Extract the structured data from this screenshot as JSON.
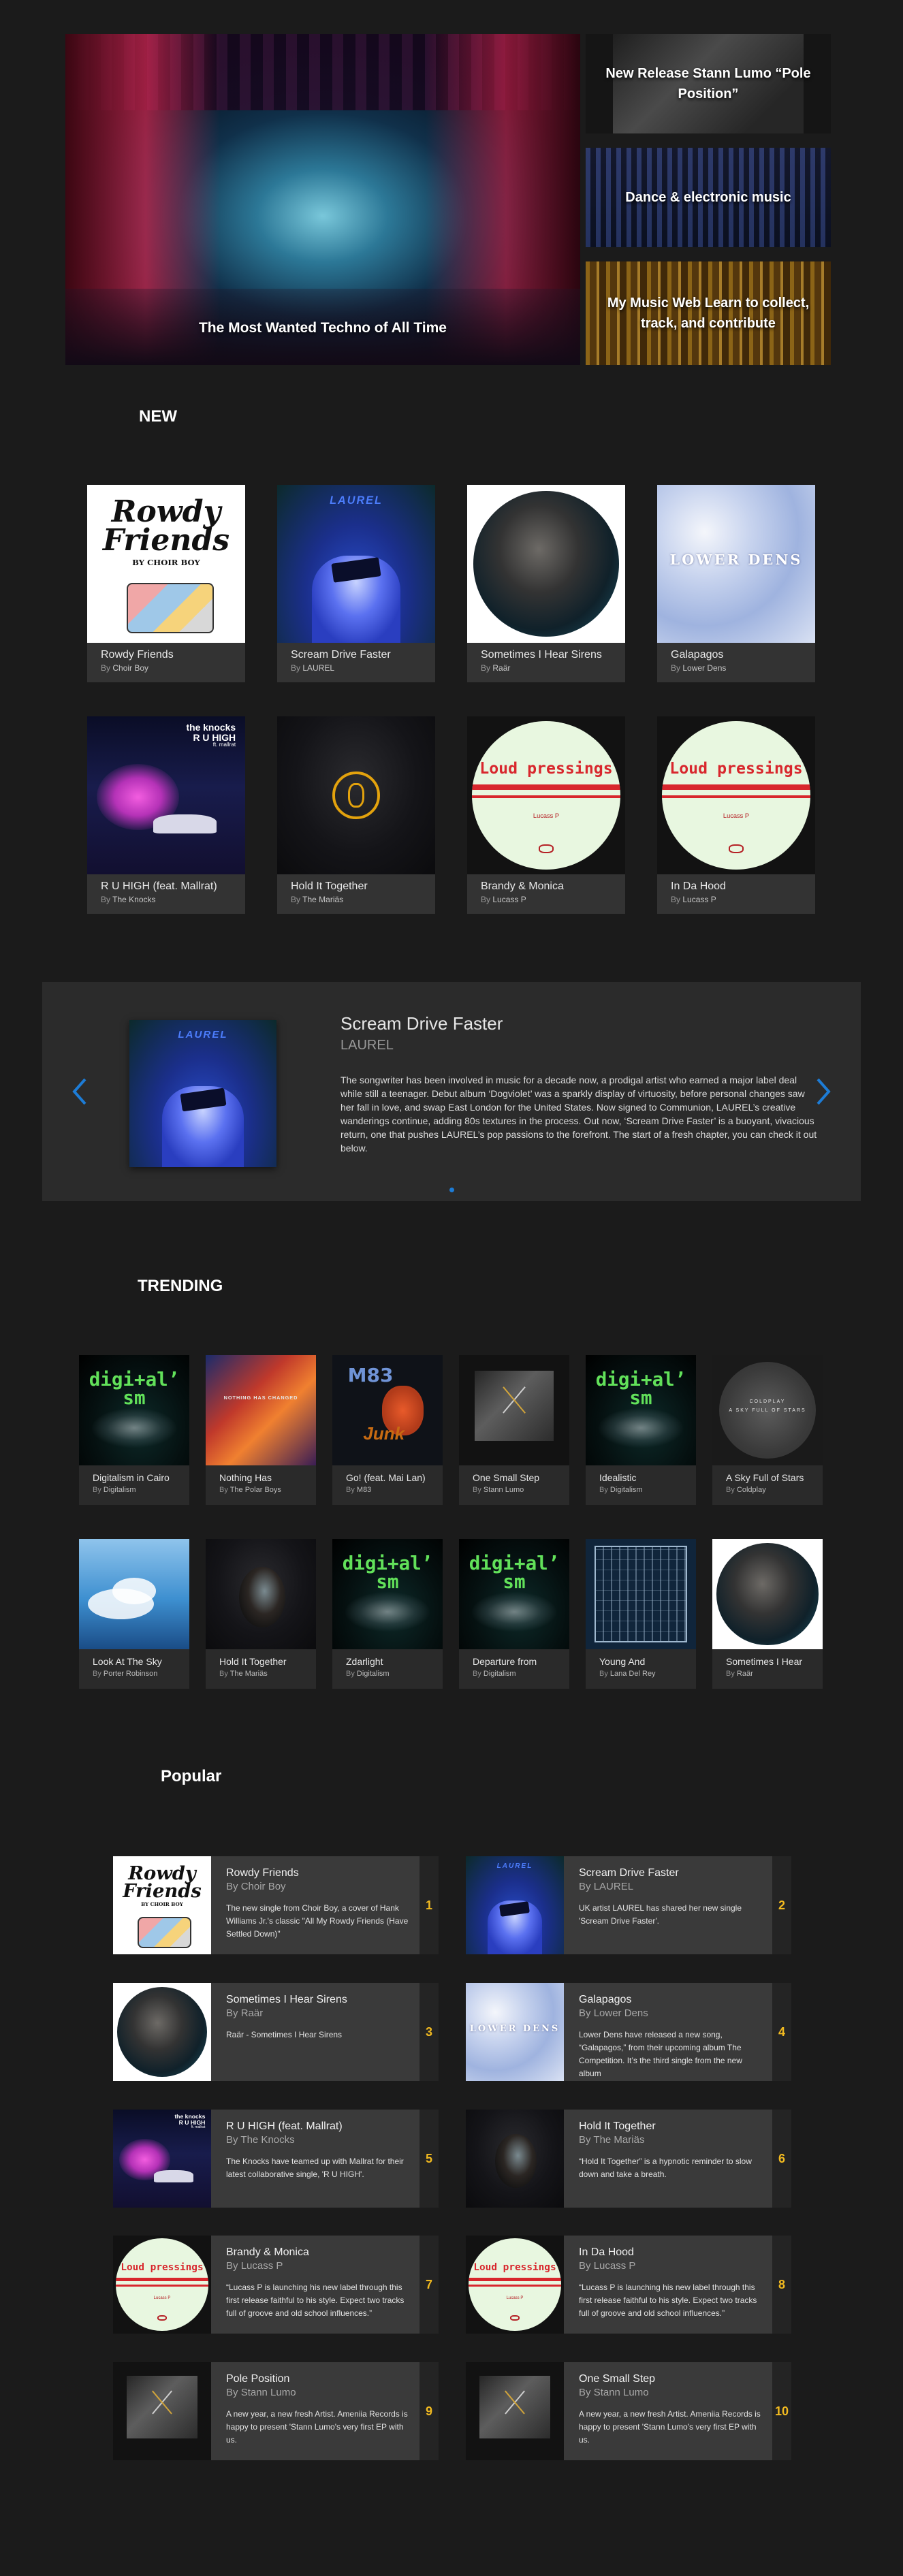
{
  "hero": {
    "main_caption": "The Most Wanted Techno of All Time",
    "side_items": [
      {
        "caption": "New Release Stann Lumo “Pole Position”"
      },
      {
        "caption": "Dance & electronic music"
      },
      {
        "caption": "My Music Web Learn to collect, track, and contribute"
      }
    ]
  },
  "new_section": {
    "title": "NEW",
    "by_prefix": "By",
    "items": [
      {
        "title": "Rowdy Friends",
        "artist": "Choir Boy",
        "art": "rowdy"
      },
      {
        "title": "Scream Drive Faster",
        "artist": "LAUREL",
        "art": "laurel"
      },
      {
        "title": "Sometimes I Hear Sirens",
        "artist": "Raär",
        "art": "sirens"
      },
      {
        "title": "Galapagos",
        "artist": "Lower Dens",
        "art": "galapagos"
      },
      {
        "title": "R U HIGH (feat. Mallrat)",
        "artist": "The Knocks",
        "art": "knocks"
      },
      {
        "title": "Hold It Together",
        "artist": "The Mariäs",
        "art": "marias"
      },
      {
        "title": "Brandy & Monica",
        "artist": "Lucass P",
        "art": "loud"
      },
      {
        "title": "In Da Hood",
        "artist": "Lucass P",
        "art": "loud"
      }
    ],
    "art_text": {
      "rowdy_line1": "Rowdy",
      "rowdy_line2": "Friends",
      "rowdy_small": "BY CHOIR BOY",
      "laurel": "LAUREL",
      "kowik": "LOWER DENS",
      "knocks_line1": "the knocks",
      "knocks_line2": "R U HIGH",
      "knocks_line3": "ft. mallrat",
      "loud": "Loud pressings",
      "loud_small": "Lucass P"
    }
  },
  "feature": {
    "title": "Scream Drive Faster",
    "artist": "LAUREL",
    "description": "The songwriter has been involved in music for a decade now, a prodigal artist who earned a major label deal while still a teenager. Debut album ‘Dogviolet’ was a sparkly display of virtuosity, before personal changes saw her fall in love, and swap East London for the United States. Now signed to Communion, LAUREL’s creative wanderings continue, adding 80s textures in the process. Out now, ‘Scream Drive Faster’ is a buoyant, vivacious return, one that pushes LAUREL’s pop passions to the forefront. The start of a fresh chapter, you can check it out below.",
    "prev_icon": "chevron-left-icon",
    "next_icon": "chevron-right-icon",
    "accent": "#1d7cd6",
    "dots_count": 1
  },
  "trending_section": {
    "title": "TRENDING",
    "by_prefix": "By",
    "items": [
      {
        "title": "Digitalism in Cairo",
        "artist": "Digitalism",
        "art": "digi"
      },
      {
        "title": "Nothing Has",
        "artist": "The Polar Boys",
        "art": "orange"
      },
      {
        "title": "Go! (feat. Mai Lan)",
        "artist": "M83",
        "art": "m83"
      },
      {
        "title": "One Small Step",
        "artist": "Stann Lumo",
        "art": "stann"
      },
      {
        "title": "Idealistic",
        "artist": "Digitalism",
        "art": "digi"
      },
      {
        "title": "A Sky Full of Stars",
        "artist": "Coldplay",
        "art": "coldplay"
      },
      {
        "title": "Look At The Sky",
        "artist": "Porter Robinson",
        "art": "sky"
      },
      {
        "title": "Hold It Together",
        "artist": "The Mariäs",
        "art": "marias"
      },
      {
        "title": "Zdarlight",
        "artist": "Digitalism",
        "art": "digi"
      },
      {
        "title": "Departure from",
        "artist": "Digitalism",
        "art": "digi"
      },
      {
        "title": "Young And",
        "artist": "Lana Del Rey",
        "art": "gatsby"
      },
      {
        "title": "Sometimes I Hear",
        "artist": "Raär",
        "art": "sirens"
      }
    ],
    "art_text": {
      "digi": "digi+al’ sm",
      "orange": "NOTHING HAS CHANGED",
      "m83": "M83",
      "junk": "Junk",
      "coldplay": "A SKY FULL OF STARS",
      "coldplay_top": "COLDPLAY"
    }
  },
  "popular_section": {
    "title": "Popular",
    "by_prefix": "By",
    "items": [
      {
        "rank": "1",
        "title": "Rowdy Friends",
        "artist": "Choir Boy",
        "desc": "The new single from Choir Boy, a cover of Hank Williams Jr.'s classic \"All My Rowdy Friends (Have Settled Down)\"",
        "art": "rowdy"
      },
      {
        "rank": "2",
        "title": "Scream Drive Faster",
        "artist": "LAUREL",
        "desc": "UK artist LAUREL has shared her new single 'Scream Drive Faster'.",
        "art": "laurel"
      },
      {
        "rank": "3",
        "title": "Sometimes I Hear Sirens",
        "artist": "Raär",
        "desc": "Raär - Sometimes I Hear Sirens",
        "art": "sirens"
      },
      {
        "rank": "4",
        "title": "Galapagos",
        "artist": "Lower Dens",
        "desc": "Lower Dens have released a new song, “Galapagos,” from their upcoming album The Competition. It’s the third single from the new album",
        "art": "galapagos"
      },
      {
        "rank": "5",
        "title": "R U HIGH (feat. Mallrat)",
        "artist": "The Knocks",
        "desc": "The Knocks have teamed up with Mallrat for their latest collaborative single, 'R U HIGH'.",
        "art": "knocks"
      },
      {
        "rank": "6",
        "title": "Hold It Together",
        "artist": "The Mariäs",
        "desc": "“Hold It Together” is a hypnotic reminder to slow down and take a breath.",
        "art": "marias"
      },
      {
        "rank": "7",
        "title": "Brandy & Monica",
        "artist": "Lucass P",
        "desc": "“Lucass P is launching his new label through this first release faithful to his style. Expect two tracks full of groove and old school influences.”",
        "art": "loud"
      },
      {
        "rank": "8",
        "title": "In Da Hood",
        "artist": "Lucass P",
        "desc": "“Lucass P is launching his new label through this first release faithful to his style. Expect two tracks full of groove and old school influences.”",
        "art": "loud"
      },
      {
        "rank": "9",
        "title": "Pole Position",
        "artist": "Stann Lumo",
        "desc": "A new year, a new fresh Artist. Ameniia Records is happy to present 'Stann Lumo's very first EP with us.",
        "art": "stann"
      },
      {
        "rank": "10",
        "title": "One Small Step",
        "artist": "Stann Lumo",
        "desc": "A new year, a new fresh Artist. Ameniia Records is happy to present 'Stann Lumo's very first EP with us.",
        "art": "stann"
      }
    ]
  },
  "colors": {
    "background": "#1b1b1b",
    "card_meta": "#333333",
    "rank_accent": "#f2ba20",
    "carousel_accent": "#1d7cd6"
  }
}
